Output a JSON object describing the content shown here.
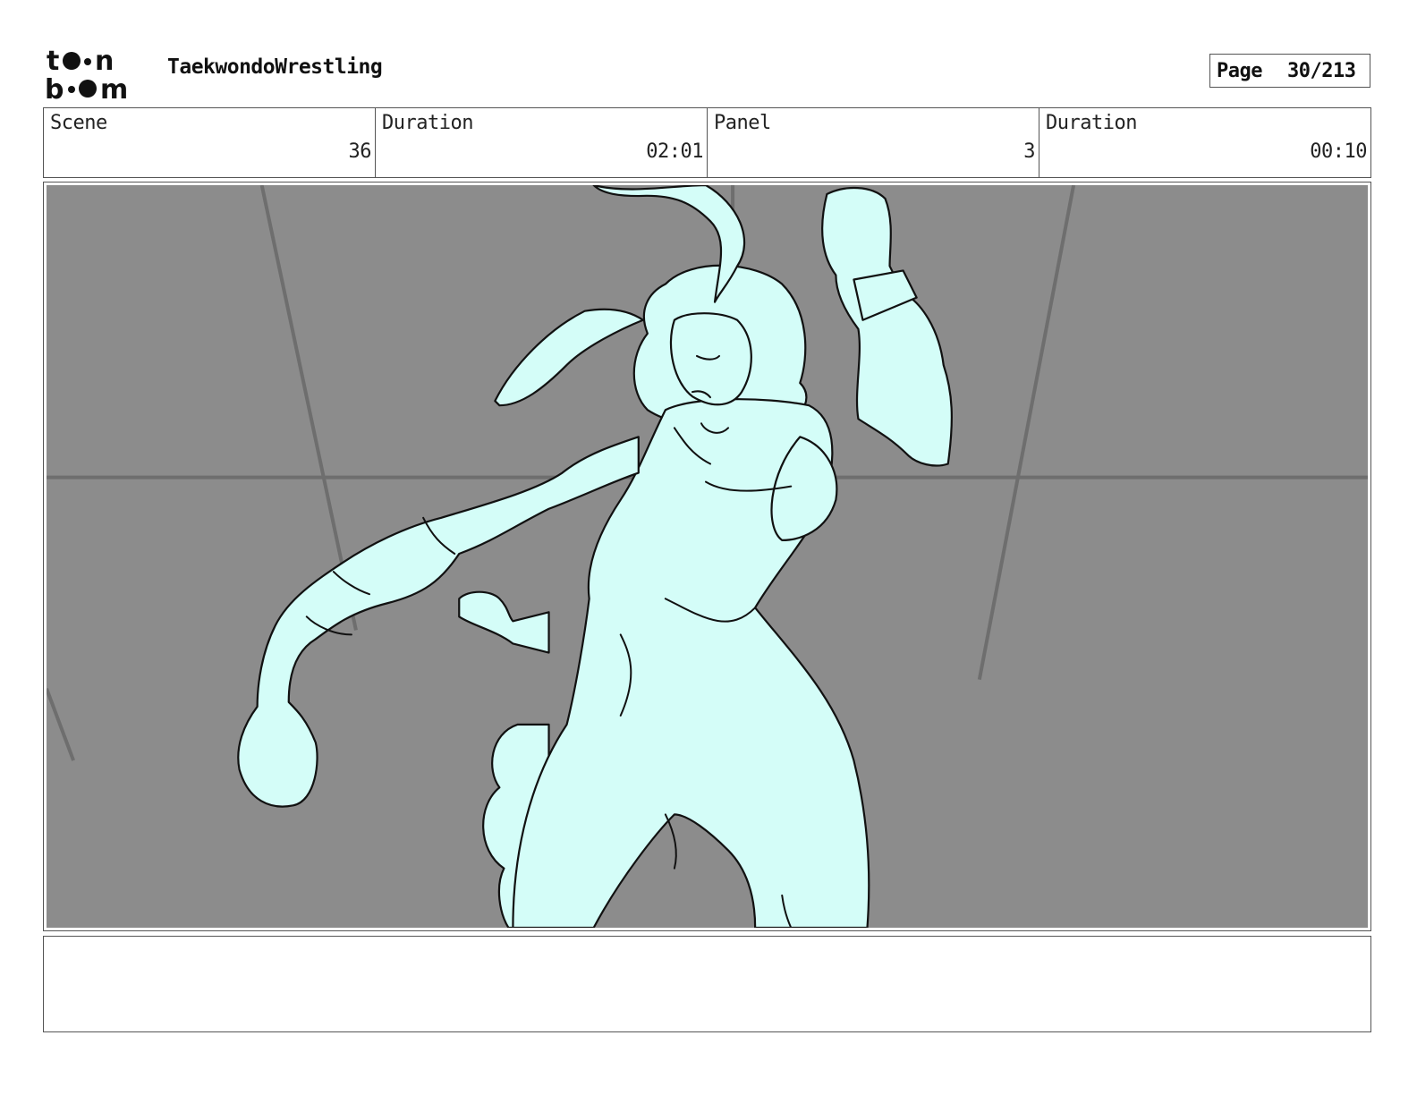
{
  "header": {
    "logo_text": "toon boom",
    "project_title": "TaekwondoWrestling",
    "page_label": "Page",
    "page_number": "30/213"
  },
  "info": {
    "scene_label": "Scene",
    "scene_value": "36",
    "scene_duration_label": "Duration",
    "scene_duration_value": "02:01",
    "panel_label": "Panel",
    "panel_value": "3",
    "panel_duration_label": "Duration",
    "panel_duration_value": "00:10"
  },
  "notes": {
    "text": ""
  },
  "colors": {
    "background_gray": "#8c8c8c",
    "character_fill": "#d4fdf8",
    "line_color": "#111111"
  }
}
